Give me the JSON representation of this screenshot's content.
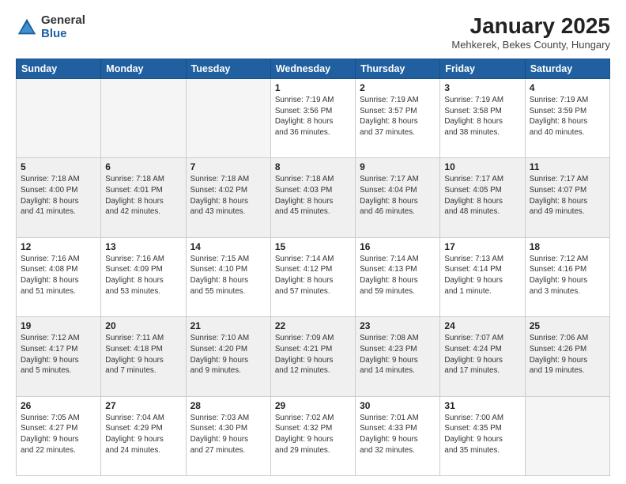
{
  "header": {
    "logo_general": "General",
    "logo_blue": "Blue",
    "title": "January 2025",
    "subtitle": "Mehkerek, Bekes County, Hungary"
  },
  "calendar": {
    "days_of_week": [
      "Sunday",
      "Monday",
      "Tuesday",
      "Wednesday",
      "Thursday",
      "Friday",
      "Saturday"
    ],
    "weeks": [
      {
        "shade": "white",
        "days": [
          {
            "num": "",
            "info": ""
          },
          {
            "num": "",
            "info": ""
          },
          {
            "num": "",
            "info": ""
          },
          {
            "num": "1",
            "info": "Sunrise: 7:19 AM\nSunset: 3:56 PM\nDaylight: 8 hours\nand 36 minutes."
          },
          {
            "num": "2",
            "info": "Sunrise: 7:19 AM\nSunset: 3:57 PM\nDaylight: 8 hours\nand 37 minutes."
          },
          {
            "num": "3",
            "info": "Sunrise: 7:19 AM\nSunset: 3:58 PM\nDaylight: 8 hours\nand 38 minutes."
          },
          {
            "num": "4",
            "info": "Sunrise: 7:19 AM\nSunset: 3:59 PM\nDaylight: 8 hours\nand 40 minutes."
          }
        ]
      },
      {
        "shade": "shaded",
        "days": [
          {
            "num": "5",
            "info": "Sunrise: 7:18 AM\nSunset: 4:00 PM\nDaylight: 8 hours\nand 41 minutes."
          },
          {
            "num": "6",
            "info": "Sunrise: 7:18 AM\nSunset: 4:01 PM\nDaylight: 8 hours\nand 42 minutes."
          },
          {
            "num": "7",
            "info": "Sunrise: 7:18 AM\nSunset: 4:02 PM\nDaylight: 8 hours\nand 43 minutes."
          },
          {
            "num": "8",
            "info": "Sunrise: 7:18 AM\nSunset: 4:03 PM\nDaylight: 8 hours\nand 45 minutes."
          },
          {
            "num": "9",
            "info": "Sunrise: 7:17 AM\nSunset: 4:04 PM\nDaylight: 8 hours\nand 46 minutes."
          },
          {
            "num": "10",
            "info": "Sunrise: 7:17 AM\nSunset: 4:05 PM\nDaylight: 8 hours\nand 48 minutes."
          },
          {
            "num": "11",
            "info": "Sunrise: 7:17 AM\nSunset: 4:07 PM\nDaylight: 8 hours\nand 49 minutes."
          }
        ]
      },
      {
        "shade": "white",
        "days": [
          {
            "num": "12",
            "info": "Sunrise: 7:16 AM\nSunset: 4:08 PM\nDaylight: 8 hours\nand 51 minutes."
          },
          {
            "num": "13",
            "info": "Sunrise: 7:16 AM\nSunset: 4:09 PM\nDaylight: 8 hours\nand 53 minutes."
          },
          {
            "num": "14",
            "info": "Sunrise: 7:15 AM\nSunset: 4:10 PM\nDaylight: 8 hours\nand 55 minutes."
          },
          {
            "num": "15",
            "info": "Sunrise: 7:14 AM\nSunset: 4:12 PM\nDaylight: 8 hours\nand 57 minutes."
          },
          {
            "num": "16",
            "info": "Sunrise: 7:14 AM\nSunset: 4:13 PM\nDaylight: 8 hours\nand 59 minutes."
          },
          {
            "num": "17",
            "info": "Sunrise: 7:13 AM\nSunset: 4:14 PM\nDaylight: 9 hours\nand 1 minute."
          },
          {
            "num": "18",
            "info": "Sunrise: 7:12 AM\nSunset: 4:16 PM\nDaylight: 9 hours\nand 3 minutes."
          }
        ]
      },
      {
        "shade": "shaded",
        "days": [
          {
            "num": "19",
            "info": "Sunrise: 7:12 AM\nSunset: 4:17 PM\nDaylight: 9 hours\nand 5 minutes."
          },
          {
            "num": "20",
            "info": "Sunrise: 7:11 AM\nSunset: 4:18 PM\nDaylight: 9 hours\nand 7 minutes."
          },
          {
            "num": "21",
            "info": "Sunrise: 7:10 AM\nSunset: 4:20 PM\nDaylight: 9 hours\nand 9 minutes."
          },
          {
            "num": "22",
            "info": "Sunrise: 7:09 AM\nSunset: 4:21 PM\nDaylight: 9 hours\nand 12 minutes."
          },
          {
            "num": "23",
            "info": "Sunrise: 7:08 AM\nSunset: 4:23 PM\nDaylight: 9 hours\nand 14 minutes."
          },
          {
            "num": "24",
            "info": "Sunrise: 7:07 AM\nSunset: 4:24 PM\nDaylight: 9 hours\nand 17 minutes."
          },
          {
            "num": "25",
            "info": "Sunrise: 7:06 AM\nSunset: 4:26 PM\nDaylight: 9 hours\nand 19 minutes."
          }
        ]
      },
      {
        "shade": "white",
        "days": [
          {
            "num": "26",
            "info": "Sunrise: 7:05 AM\nSunset: 4:27 PM\nDaylight: 9 hours\nand 22 minutes."
          },
          {
            "num": "27",
            "info": "Sunrise: 7:04 AM\nSunset: 4:29 PM\nDaylight: 9 hours\nand 24 minutes."
          },
          {
            "num": "28",
            "info": "Sunrise: 7:03 AM\nSunset: 4:30 PM\nDaylight: 9 hours\nand 27 minutes."
          },
          {
            "num": "29",
            "info": "Sunrise: 7:02 AM\nSunset: 4:32 PM\nDaylight: 9 hours\nand 29 minutes."
          },
          {
            "num": "30",
            "info": "Sunrise: 7:01 AM\nSunset: 4:33 PM\nDaylight: 9 hours\nand 32 minutes."
          },
          {
            "num": "31",
            "info": "Sunrise: 7:00 AM\nSunset: 4:35 PM\nDaylight: 9 hours\nand 35 minutes."
          },
          {
            "num": "",
            "info": ""
          }
        ]
      }
    ]
  }
}
